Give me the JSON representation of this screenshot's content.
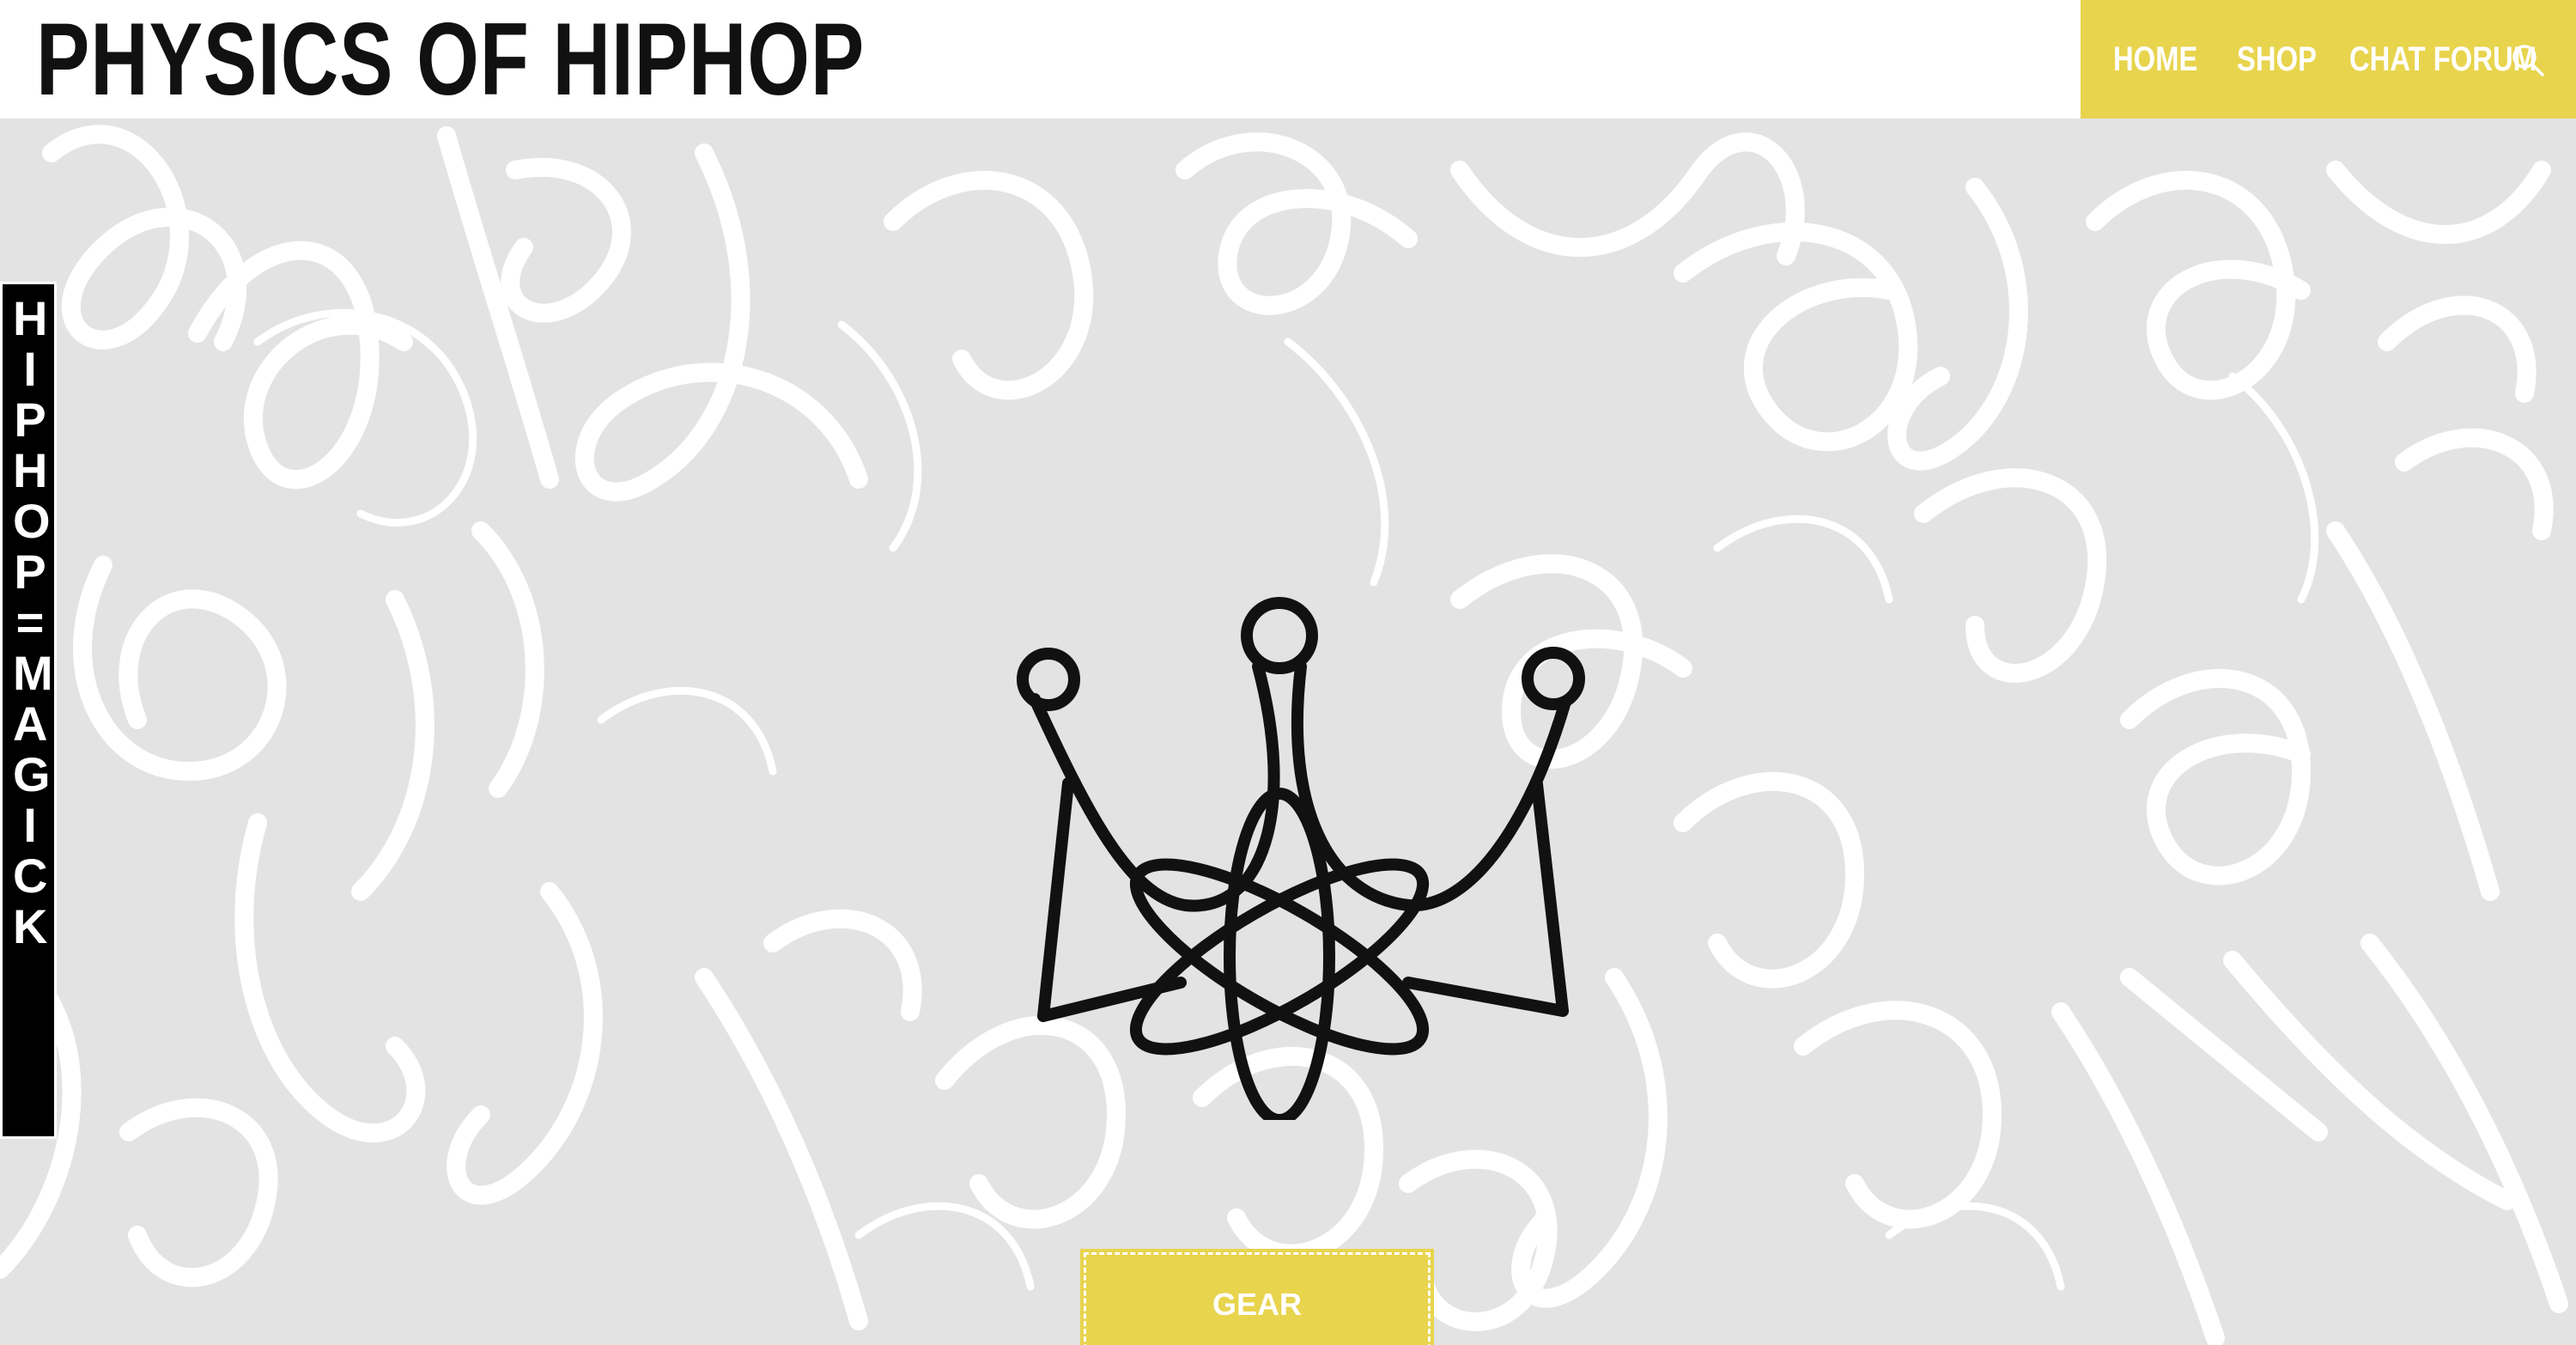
{
  "site": {
    "title": "PHYSICS OF HIPHOP"
  },
  "nav": {
    "items": [
      {
        "label": "HOME"
      },
      {
        "label": "SHOP"
      },
      {
        "label": "CHAT FORUM"
      }
    ],
    "search_icon": "search-icon"
  },
  "hero": {
    "side_banner_text": "HIPHOP=MAGICK",
    "logo_icon": "crown-atom-logo",
    "cta_label": "GEAR"
  },
  "colors": {
    "accent": "#e8d44d",
    "background": "#e3e3e3",
    "graffiti": "#ffffff",
    "text": "#111111"
  }
}
